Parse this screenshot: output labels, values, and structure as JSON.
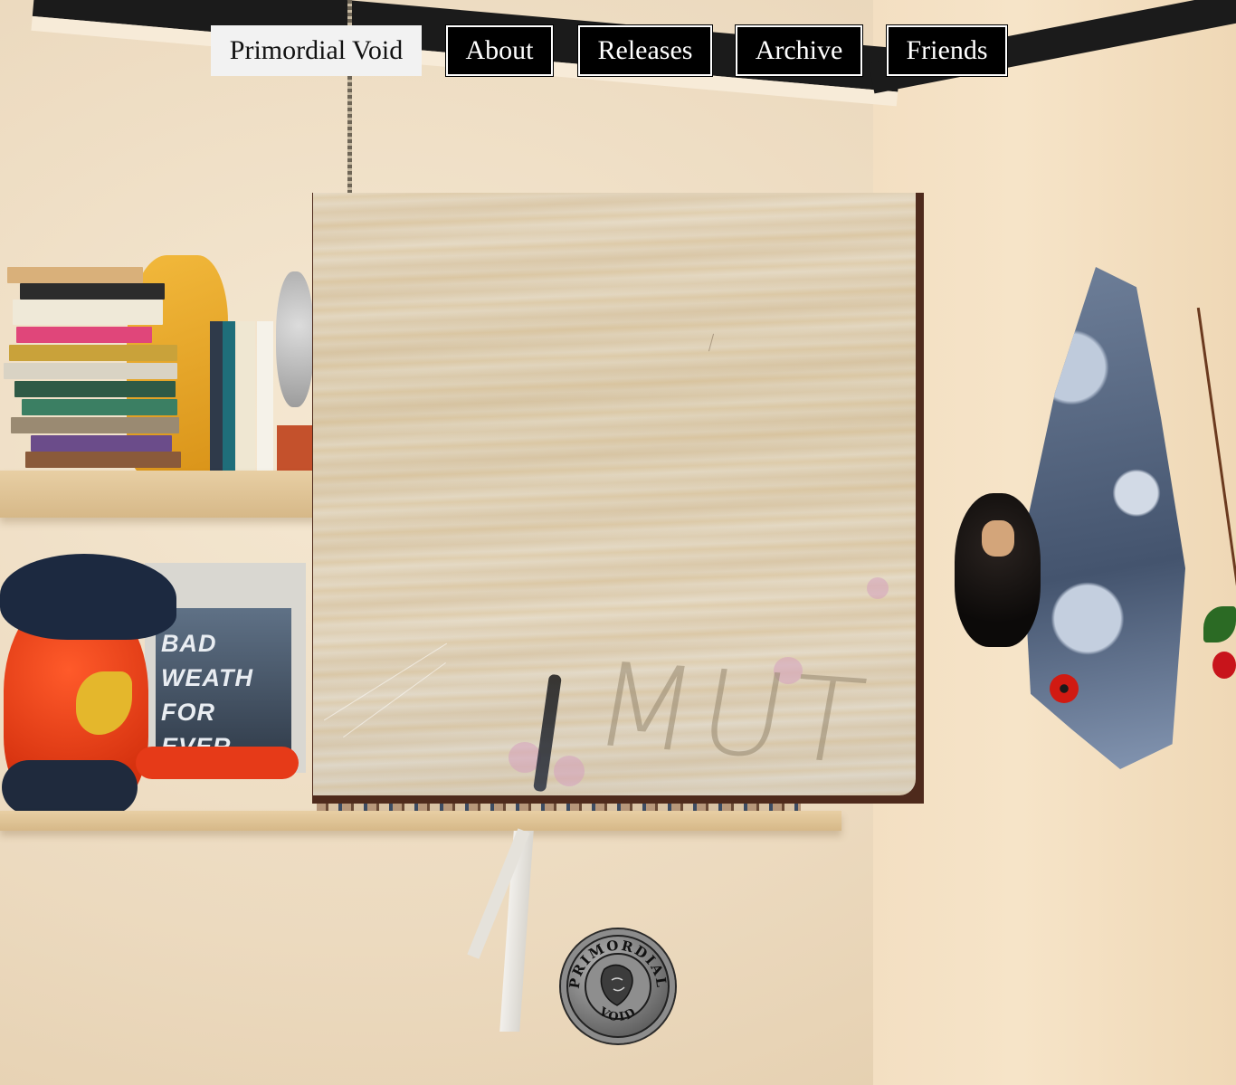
{
  "nav": {
    "home_label": "Primordial Void",
    "items": [
      {
        "label": "About"
      },
      {
        "label": "Releases"
      },
      {
        "label": "Archive"
      },
      {
        "label": "Friends"
      }
    ]
  },
  "panel": {
    "scratched_text": "MUT"
  },
  "background": {
    "record_text": [
      "BAD",
      "WEATH",
      "FOR",
      "EVER"
    ]
  },
  "seal": {
    "top_text": "PRIMORDIAL",
    "bottom_text": "VOID"
  },
  "colors": {
    "nav_link_bg": "#000000",
    "nav_link_text": "#ffffff",
    "nav_home_bg": "#f2f2f2",
    "nav_home_text": "#111111"
  }
}
